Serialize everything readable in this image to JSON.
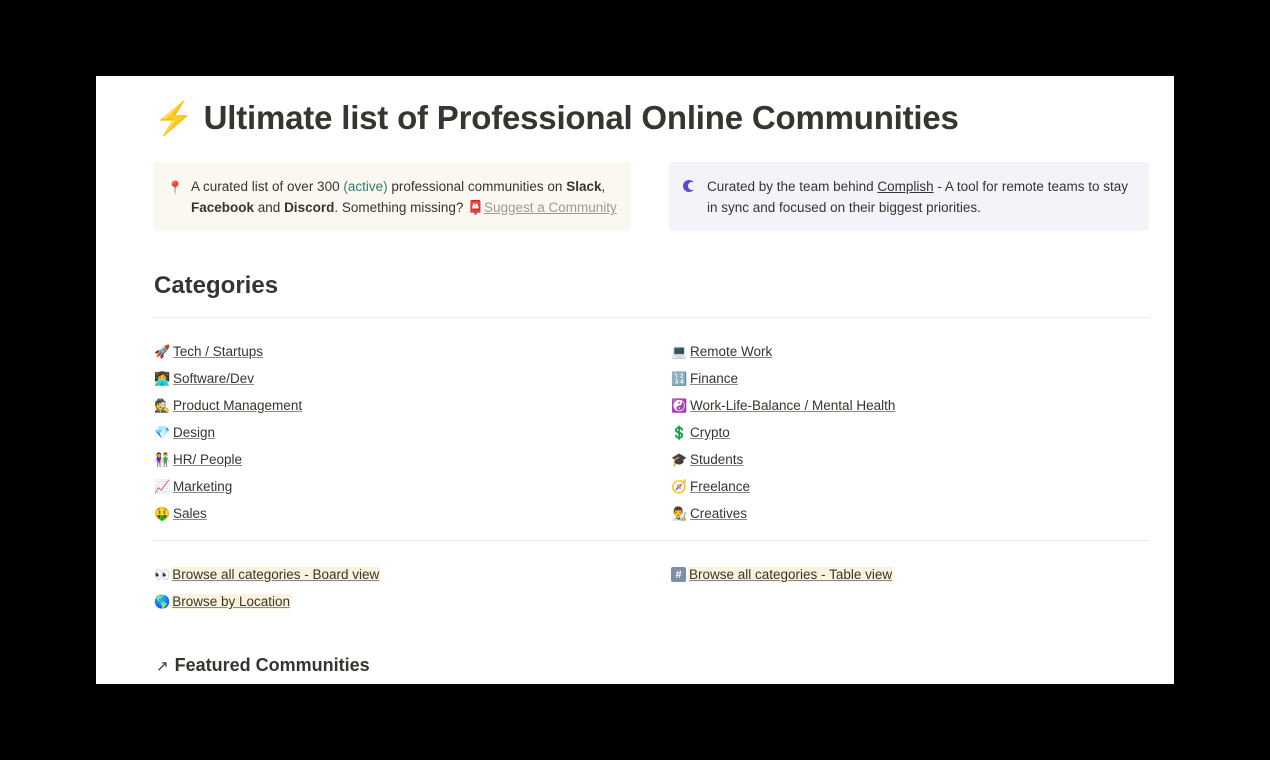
{
  "page": {
    "title_icon": "⚡",
    "title": "Ultimate list of Professional Online Communities"
  },
  "callout_left": {
    "icon": "pin-icon",
    "glyph": "📍",
    "text_a": "A curated list of over 300 ",
    "active": "(active)",
    "text_b": " professional communities on ",
    "slack": "Slack",
    "comma": ",",
    "facebook": "Facebook",
    "and": " and ",
    "discord": "Discord",
    "text_c": ". Something missing?  ",
    "suggest_glyph": "📮",
    "suggest_link": "Suggest a Community"
  },
  "callout_right": {
    "icon": "complish-logo-icon",
    "text_a": "Curated by the team behind ",
    "complish_link": "Complish",
    "text_b": " - A tool for remote teams to stay in sync and focused on their biggest priorities."
  },
  "categories_heading": "Categories",
  "categories_left": [
    {
      "emoji": "🚀",
      "label": "Tech / Startups"
    },
    {
      "emoji": "👩‍💻",
      "label": "Software/Dev"
    },
    {
      "emoji": "🕵️",
      "label": "Product Management"
    },
    {
      "emoji": "💎",
      "label": "Design"
    },
    {
      "emoji": "👫",
      "label": "HR/ People"
    },
    {
      "emoji": "📈",
      "label": "Marketing "
    },
    {
      "emoji": "🤑",
      "label": "Sales"
    }
  ],
  "categories_right": [
    {
      "emoji": "💻",
      "label": "Remote Work"
    },
    {
      "emoji": "🔢",
      "label": "Finance"
    },
    {
      "emoji": "☯️",
      "label": "Work-Life-Balance / Mental Health"
    },
    {
      "emoji": "💲",
      "label": "Crypto"
    },
    {
      "emoji": "🎓",
      "label": "Students"
    },
    {
      "emoji": "🧭",
      "label": "Freelance"
    },
    {
      "emoji": "👨‍🎨",
      "label": "Creatives "
    }
  ],
  "browse": {
    "board": {
      "emoji": "👀",
      "label": "Browse all categories - Board view"
    },
    "location": {
      "emoji": "🌎",
      "label": "Browse by Location"
    },
    "table": {
      "emoji": "#",
      "label": "Browse all categories - Table view"
    }
  },
  "featured": {
    "arrow": "↗",
    "heading": "Featured Communities"
  }
}
